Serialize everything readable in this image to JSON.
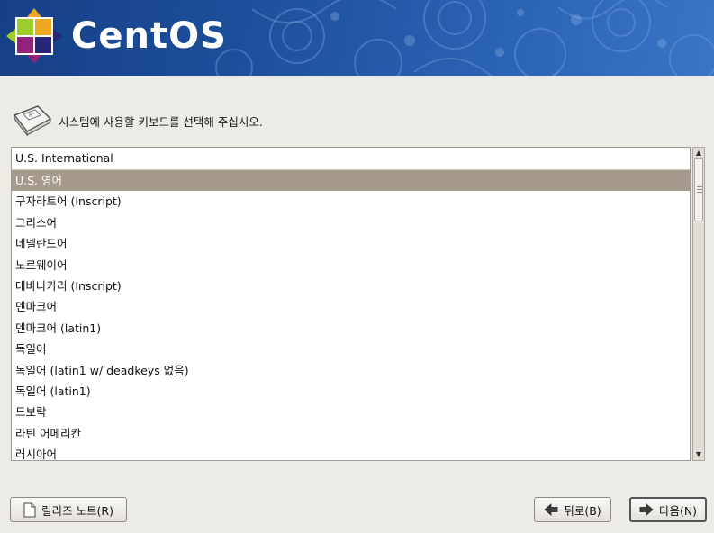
{
  "banner": {
    "brand": "CentOS",
    "logo_icon": "centos-logo-icon"
  },
  "prompt": {
    "icon": "keyboard-icon",
    "text": "시스템에 사용할 키보드를 선택해 주십시오."
  },
  "keyboard_list": {
    "selected_index": 1,
    "items": [
      "U.S. International",
      "U.S. 영어",
      "구자라트어 (Inscript)",
      "그리스어",
      "네델란드어",
      "노르웨이어",
      "데바나가리 (Inscript)",
      "덴마크어",
      "덴마크어 (latin1)",
      "독일어",
      "독일어 (latin1 w/ deadkeys 없음)",
      "독일어 (latin1)",
      "드보락",
      "라틴 어메리칸",
      "러시아어"
    ]
  },
  "buttons": {
    "release_notes": {
      "label": "릴리즈 노트(R)",
      "icon": "document-icon"
    },
    "back": {
      "label": "뒤로(B)",
      "icon": "arrow-left-icon"
    },
    "next": {
      "label": "다음(N)",
      "icon": "arrow-right-icon"
    }
  },
  "colors": {
    "banner": "#1d4f9c",
    "selection": "#a59a8b",
    "background": "#edebe6"
  }
}
